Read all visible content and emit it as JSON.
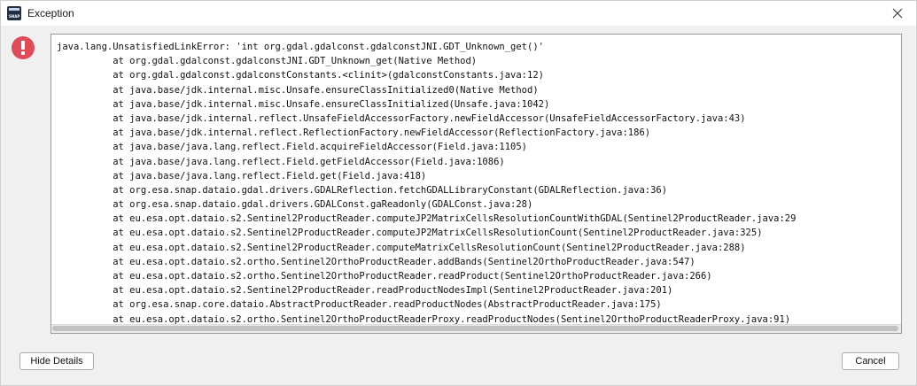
{
  "window": {
    "title": "Exception",
    "app_icon_text": "SNAP"
  },
  "trace": {
    "lines": [
      "java.lang.UnsatisfiedLinkError: 'int org.gdal.gdalconst.gdalconstJNI.GDT_Unknown_get()'",
      "\tat org.gdal.gdalconst.gdalconstJNI.GDT_Unknown_get(Native Method)",
      "\tat org.gdal.gdalconst.gdalconstConstants.<clinit>(gdalconstConstants.java:12)",
      "\tat java.base/jdk.internal.misc.Unsafe.ensureClassInitialized0(Native Method)",
      "\tat java.base/jdk.internal.misc.Unsafe.ensureClassInitialized(Unsafe.java:1042)",
      "\tat java.base/jdk.internal.reflect.UnsafeFieldAccessorFactory.newFieldAccessor(UnsafeFieldAccessorFactory.java:43)",
      "\tat java.base/jdk.internal.reflect.ReflectionFactory.newFieldAccessor(ReflectionFactory.java:186)",
      "\tat java.base/java.lang.reflect.Field.acquireFieldAccessor(Field.java:1105)",
      "\tat java.base/java.lang.reflect.Field.getFieldAccessor(Field.java:1086)",
      "\tat java.base/java.lang.reflect.Field.get(Field.java:418)",
      "\tat org.esa.snap.dataio.gdal.drivers.GDALReflection.fetchGDALLibraryConstant(GDALReflection.java:36)",
      "\tat org.esa.snap.dataio.gdal.drivers.GDALConst.gaReadonly(GDALConst.java:28)",
      "\tat eu.esa.opt.dataio.s2.Sentinel2ProductReader.computeJP2MatrixCellsResolutionCountWithGDAL(Sentinel2ProductReader.java:29",
      "\tat eu.esa.opt.dataio.s2.Sentinel2ProductReader.computeJP2MatrixCellsResolutionCount(Sentinel2ProductReader.java:325)",
      "\tat eu.esa.opt.dataio.s2.Sentinel2ProductReader.computeMatrixCellsResolutionCount(Sentinel2ProductReader.java:288)",
      "\tat eu.esa.opt.dataio.s2.ortho.Sentinel2OrthoProductReader.addBands(Sentinel2OrthoProductReader.java:547)",
      "\tat eu.esa.opt.dataio.s2.ortho.Sentinel2OrthoProductReader.readProduct(Sentinel2OrthoProductReader.java:266)",
      "\tat eu.esa.opt.dataio.s2.Sentinel2ProductReader.readProductNodesImpl(Sentinel2ProductReader.java:201)",
      "\tat org.esa.snap.core.dataio.AbstractProductReader.readProductNodes(AbstractProductReader.java:175)",
      "\tat eu.esa.opt.dataio.s2.ortho.Sentinel2OrthoProductReaderProxy.readProductNodes(Sentinel2OrthoProductReaderProxy.java:91)"
    ]
  },
  "buttons": {
    "hide_details": "Hide Details",
    "cancel": "Cancel"
  },
  "icons": {
    "close": "close-icon",
    "error": "error-icon"
  },
  "colors": {
    "error_red": "#e04b5a",
    "background": "#f0f0f0"
  }
}
